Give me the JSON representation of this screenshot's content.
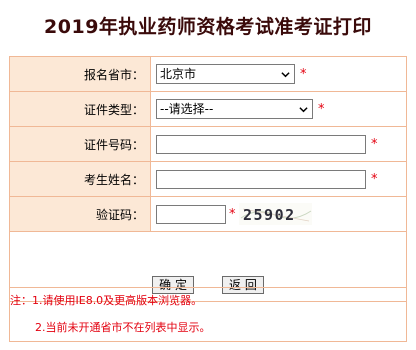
{
  "page": {
    "title": "2019年执业药师资格考试准考证打印"
  },
  "form": {
    "province": {
      "label": "报名省市：",
      "value": "北京市"
    },
    "cert_type": {
      "label": "证件类型：",
      "value": "--请选择--"
    },
    "cert_number": {
      "label": "证件号码：",
      "value": ""
    },
    "name": {
      "label": "考生姓名：",
      "value": ""
    },
    "captcha": {
      "label": "验证码：",
      "value": "",
      "image_text": "25902"
    },
    "required_mark": "*"
  },
  "buttons": {
    "confirm": "确 定",
    "back": "返 回"
  },
  "notes": {
    "line1": "注：1.请使用IE8.0及更高版本浏览器。",
    "line2": "2.当前未开通省市不在列表中显示。"
  },
  "colors": {
    "accent": "#e3000f",
    "label_bg": "#fce8d6",
    "border": "#f0b896",
    "title": "#3a0a0a"
  }
}
